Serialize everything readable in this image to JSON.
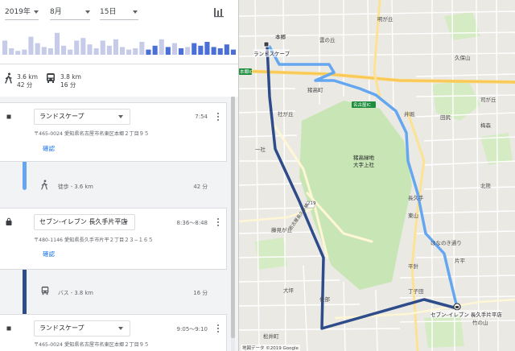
{
  "date_selector": {
    "year": "2019年",
    "month": "8月",
    "day": "15日"
  },
  "chart_icon": "bar-chart-icon",
  "histogram": {
    "colors": {
      "past": "#c5cbe8",
      "current": "#4a6fd6"
    },
    "bars": [
      {
        "h": 0.55,
        "c": "past"
      },
      {
        "h": 0.25,
        "c": "past"
      },
      {
        "h": 0.15,
        "c": "past"
      },
      {
        "h": 0.2,
        "c": "past"
      },
      {
        "h": 0.7,
        "c": "past"
      },
      {
        "h": 0.45,
        "c": "past"
      },
      {
        "h": 0.3,
        "c": "past"
      },
      {
        "h": 0.25,
        "c": "past"
      },
      {
        "h": 0.85,
        "c": "past"
      },
      {
        "h": 0.35,
        "c": "past"
      },
      {
        "h": 0.2,
        "c": "past"
      },
      {
        "h": 0.55,
        "c": "past"
      },
      {
        "h": 0.65,
        "c": "past"
      },
      {
        "h": 0.4,
        "c": "past"
      },
      {
        "h": 0.25,
        "c": "past"
      },
      {
        "h": 0.55,
        "c": "past"
      },
      {
        "h": 0.35,
        "c": "past"
      },
      {
        "h": 0.6,
        "c": "past"
      },
      {
        "h": 0.3,
        "c": "past"
      },
      {
        "h": 0.2,
        "c": "past"
      },
      {
        "h": 0.25,
        "c": "past"
      },
      {
        "h": 0.5,
        "c": "past"
      },
      {
        "h": 0.2,
        "c": "current"
      },
      {
        "h": 0.35,
        "c": "current"
      },
      {
        "h": 0.6,
        "c": "past"
      },
      {
        "h": 0.3,
        "c": "current"
      },
      {
        "h": 0.45,
        "c": "past"
      },
      {
        "h": 0.25,
        "c": "current"
      },
      {
        "h": 0.3,
        "c": "past"
      },
      {
        "h": 0.45,
        "c": "current"
      },
      {
        "h": 0.35,
        "c": "current"
      },
      {
        "h": 0.5,
        "c": "current"
      },
      {
        "h": 0.3,
        "c": "current"
      },
      {
        "h": 0.25,
        "c": "current"
      },
      {
        "h": 0.4,
        "c": "current"
      },
      {
        "h": 0.2,
        "c": "current"
      }
    ]
  },
  "summary": {
    "walk": {
      "icon": "walking-icon",
      "distance": "3.6 km",
      "duration": "42 分"
    },
    "bus": {
      "icon": "bus-icon",
      "distance": "3.8 km",
      "duration": "16 分"
    }
  },
  "timeline": {
    "stops": [
      {
        "icon": "stop-square-icon",
        "place": "ランドスケープ",
        "time": "7:54",
        "address": "〒465-0024 愛知県名古屋市名東区本郷２丁目９５",
        "confirm": "確認"
      },
      {
        "icon": "shopping-bag-icon",
        "place": "セブン-イレブン 長久手片平店",
        "time": "8:36〜8:48",
        "address": "〒480-1146 愛知県長久手市片平２丁目２３−１６５",
        "confirm": "確認"
      },
      {
        "icon": "stop-square-icon",
        "place": "ランドスケープ",
        "time": "9:05〜9:10",
        "address": "〒465-0024 愛知県名古屋市名東区本郷２丁目９５"
      }
    ],
    "segments": [
      {
        "icon": "walking-icon",
        "label": "徒歩 - 3.6 km",
        "duration": "42 分"
      },
      {
        "icon": "bus-icon",
        "label": "バス - 3.8 km",
        "duration": "16 分"
      }
    ],
    "colors": {
      "walk": "#64a7f0",
      "bus": "#2e4c8a"
    }
  },
  "map": {
    "labels": {
      "hongo": "本郷",
      "landscape": "ランドスケープ",
      "hongo_ic": "本郷IC",
      "meitozan": "明が丘",
      "kumonoike": "雲の丘",
      "kubokubo": "久保山",
      "inokoshi": "猪高町",
      "meito_ic": "名古屋IC",
      "shadai": "社が丘",
      "igaoka": "井堀",
      "igataka": "猪高緑地",
      "ogata": "大字上社",
      "tsukasadai": "司が丘",
      "tajiri": "田尻",
      "kitakata": "北熊",
      "higashi": "東山",
      "katahira": "片平",
      "hanamizuki": "はなのき通り",
      "seven": "セブン-イレブン 長久手片平店",
      "takenoyama": "竹の山",
      "matsunoki": "松井町",
      "shijin": "仕部",
      "chojin": "丁子田",
      "hakuro": "藤見が丘",
      "nagakute": "長久手",
      "meito_ave": "名古屋長久手線",
      "route219": "219",
      "hirabari": "平針",
      "attribution": "地図データ ©2019 Google",
      "hatsuyama": "大坪",
      "kakeda": "梅森",
      "bessho": "一社"
    }
  }
}
